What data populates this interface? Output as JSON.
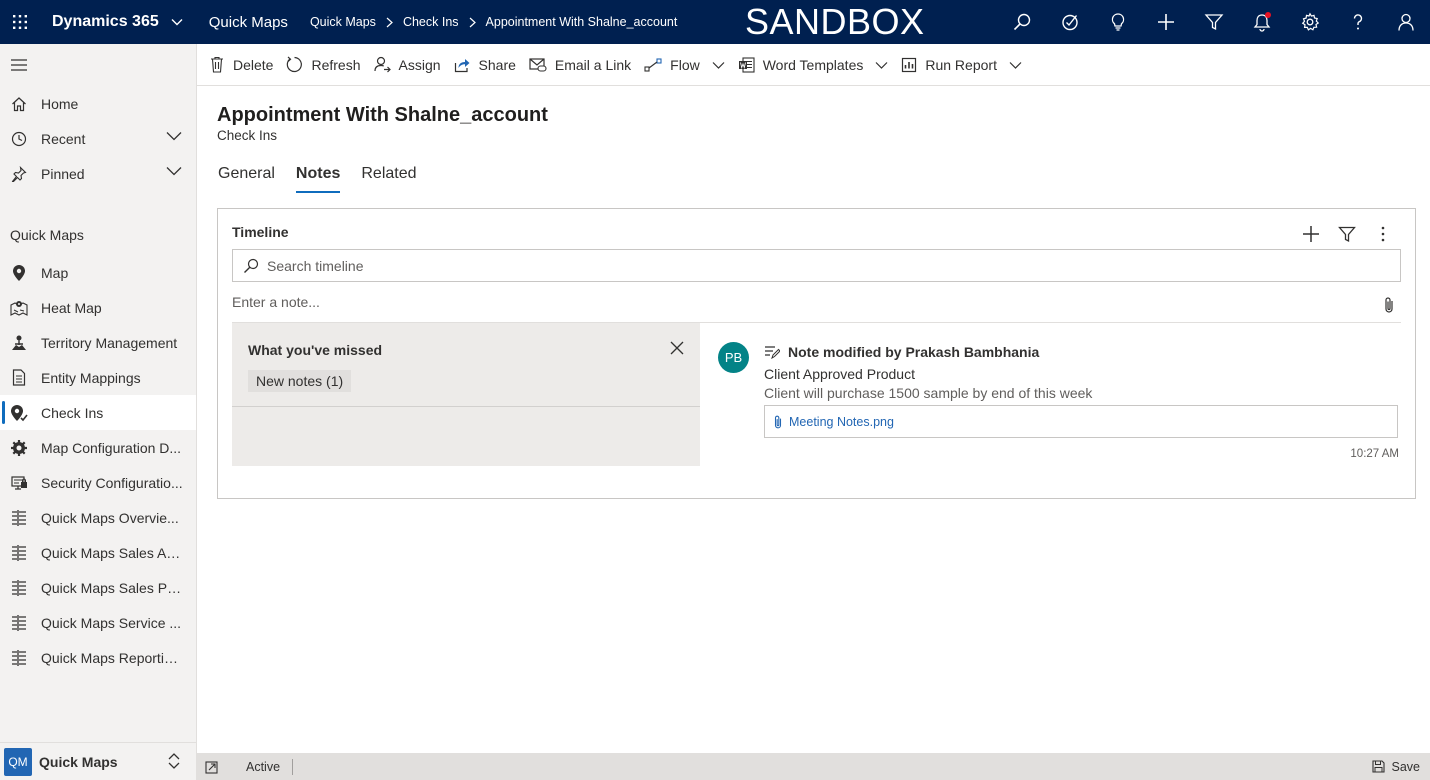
{
  "topbar": {
    "app_name": "Dynamics 365",
    "app_area": "Quick Maps",
    "breadcrumbs": [
      "Quick Maps",
      "Check Ins",
      "Appointment With Shalne_account"
    ],
    "environment_banner": "SANDBOX",
    "icons": [
      "search-icon",
      "task-icon",
      "lightbulb-icon",
      "plus-icon",
      "filter-icon",
      "bell-icon",
      "gear-icon",
      "help-icon",
      "person-icon"
    ],
    "background_color": "#002050"
  },
  "sidebar": {
    "top_items": [
      {
        "label": "Home",
        "icon": "home-icon"
      },
      {
        "label": "Recent",
        "icon": "clock-icon"
      },
      {
        "label": "Pinned",
        "icon": "pin-icon"
      }
    ],
    "section_title": "Quick Maps",
    "items": [
      {
        "label": "Map",
        "icon": "map-marker-icon"
      },
      {
        "label": "Heat Map",
        "icon": "heat-map-icon"
      },
      {
        "label": "Territory Management",
        "icon": "territory-icon"
      },
      {
        "label": "Entity Mappings",
        "icon": "document-icon"
      },
      {
        "label": "Check Ins",
        "icon": "check-in-icon",
        "active": true
      },
      {
        "label": "Map Configuration D...",
        "icon": "gear-icon"
      },
      {
        "label": "Security Configuratio...",
        "icon": "security-icon"
      },
      {
        "label": "Quick Maps Overvie...",
        "icon": "dashboard-icon"
      },
      {
        "label": "Quick Maps Sales Act...",
        "icon": "dashboard-icon"
      },
      {
        "label": "Quick Maps Sales Per...",
        "icon": "dashboard-icon"
      },
      {
        "label": "Quick Maps Service ...",
        "icon": "dashboard-icon"
      },
      {
        "label": "Quick Maps Reportin...",
        "icon": "dashboard-icon"
      }
    ],
    "area_badge": "QM",
    "area_name": "Quick Maps"
  },
  "commands": [
    {
      "label": "Delete",
      "icon": "trash-icon"
    },
    {
      "label": "Refresh",
      "icon": "refresh-icon"
    },
    {
      "label": "Assign",
      "icon": "assign-icon"
    },
    {
      "label": "Share",
      "icon": "share-icon"
    },
    {
      "label": "Email a Link",
      "icon": "email-link-icon"
    },
    {
      "label": "Flow",
      "icon": "flow-icon"
    },
    {
      "label": "Word Templates",
      "icon": "word-icon"
    },
    {
      "label": "Run Report",
      "icon": "report-icon"
    }
  ],
  "record": {
    "title": "Appointment With Shalne_account",
    "entity": "Check Ins",
    "tabs": [
      "General",
      "Notes",
      "Related"
    ],
    "selected_tab": "Notes"
  },
  "timeline": {
    "title": "Timeline",
    "search_placeholder": "Search timeline",
    "note_placeholder": "Enter a note...",
    "missed": {
      "title": "What you've missed",
      "chip": "New notes (1)"
    },
    "post": {
      "avatar": "PB",
      "header": "Note modified by Prakash Bambhania",
      "subject": "Client Approved Product",
      "body": "Client will purchase 1500 sample by end of this week",
      "attachment": "Meeting Notes.png",
      "time": "10:27 AM"
    }
  },
  "statusbar": {
    "status": "Active",
    "save_label": "Save"
  },
  "colors": {
    "accent": "#0f6cbd",
    "avatar": "#038387",
    "link": "#2266b3"
  }
}
